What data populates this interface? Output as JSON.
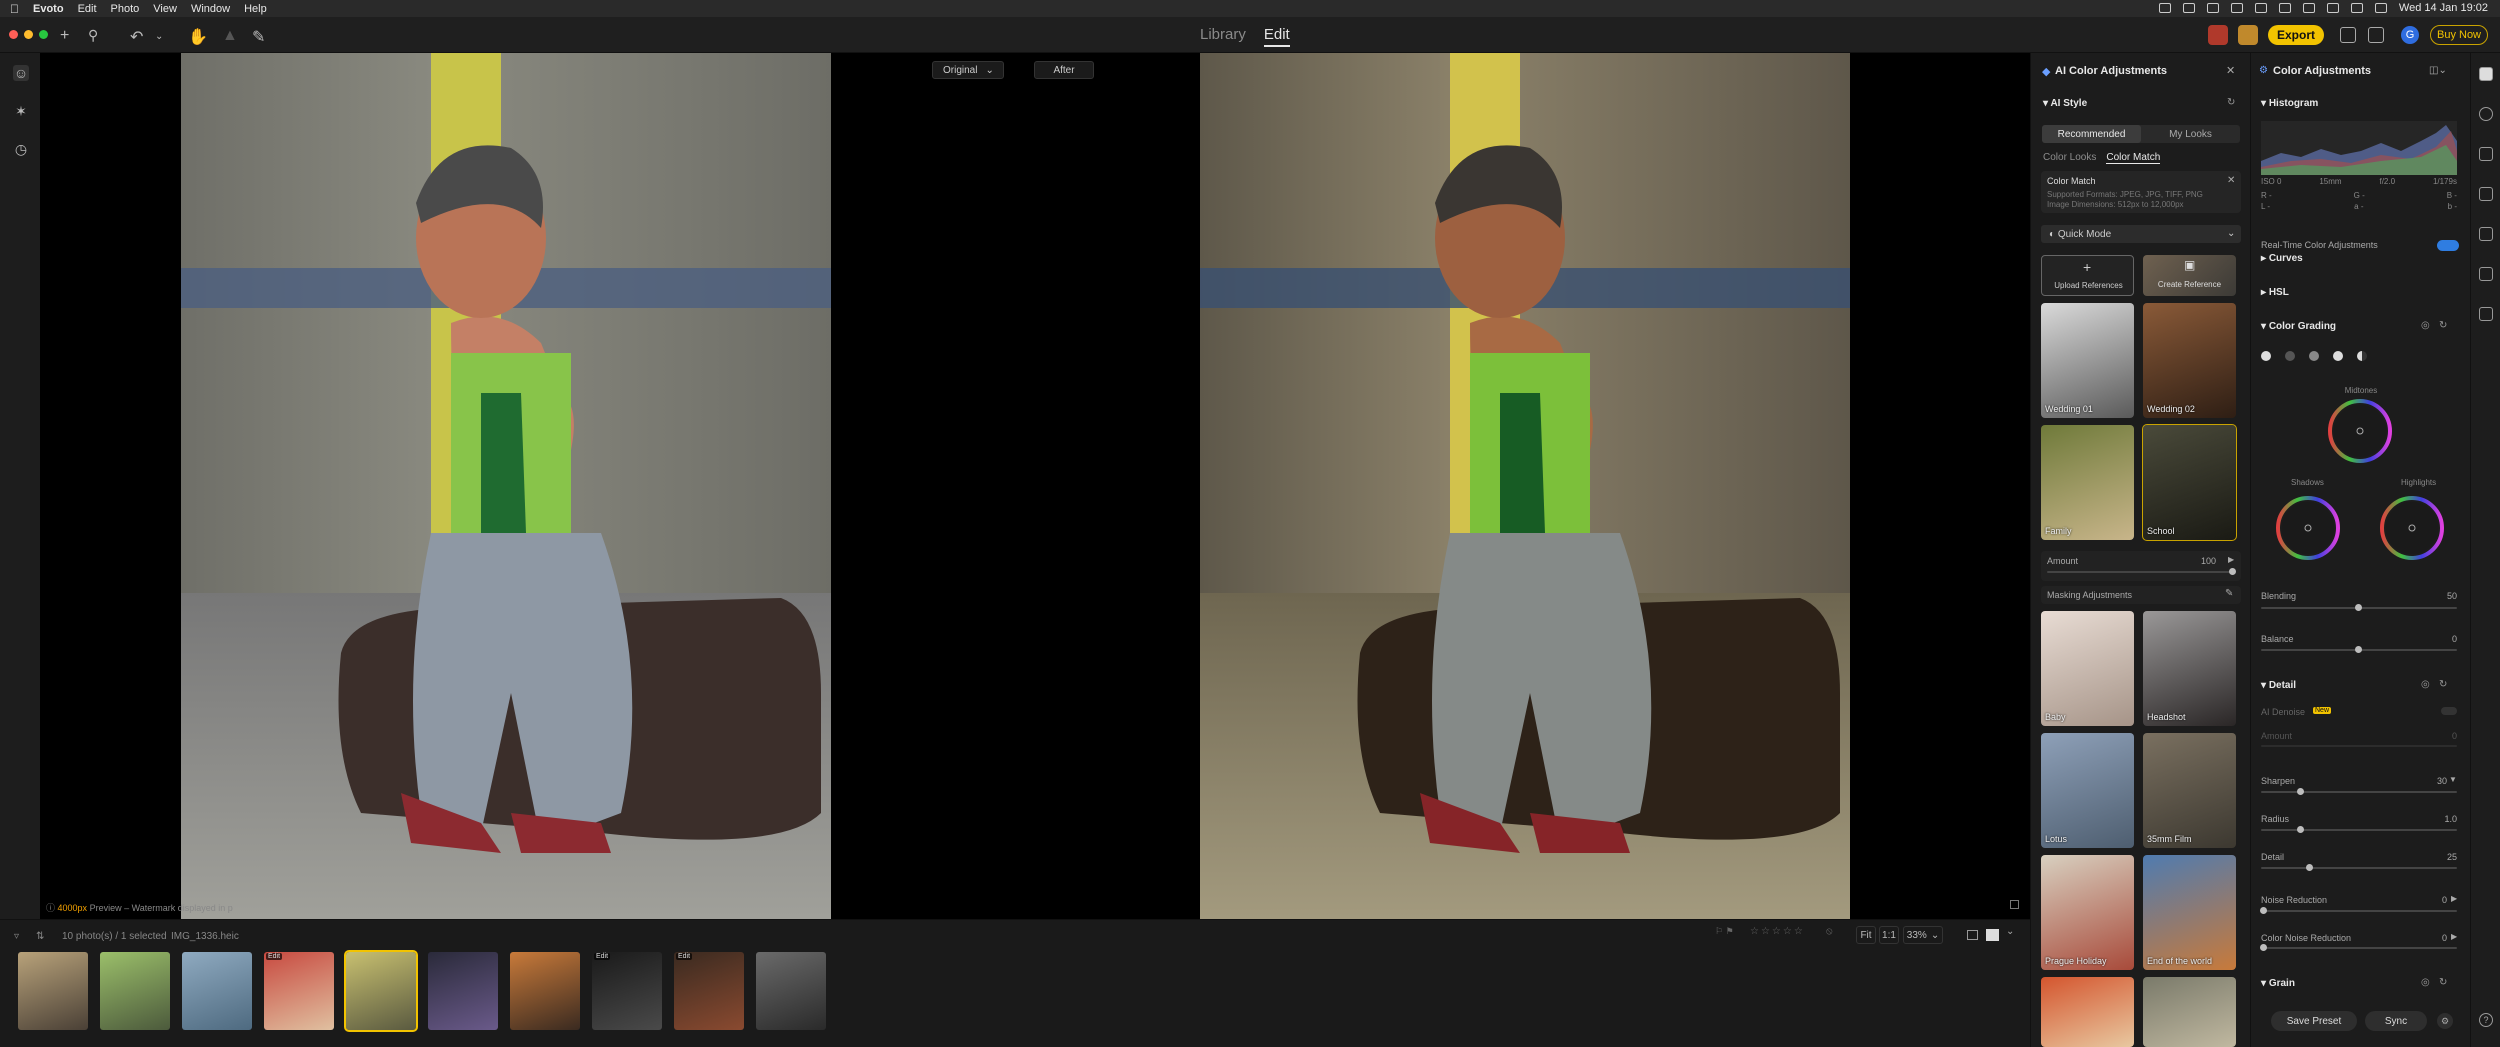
{
  "menubar": {
    "app": "Evoto",
    "items": [
      "Edit",
      "Photo",
      "View",
      "Window",
      "Help"
    ],
    "datetime": "Wed 14 Jan  19:02"
  },
  "toolbar": {
    "tabs": [
      {
        "label": "Library"
      },
      {
        "label": "Edit"
      }
    ],
    "export_label": "Export",
    "buy_label": "Buy Now",
    "avatar_letter": "G"
  },
  "compare": {
    "original_label": "Original",
    "after_label": "After"
  },
  "canvas": {
    "preview_highlight": "4000px",
    "preview_text": " Preview – Watermark displayed in p"
  },
  "filmstrip": {
    "count_text": "10 photo(s) / 1 selected",
    "filename": "IMG_1336.heic",
    "fit_label": "Fit",
    "one_to_one": "1:1",
    "zoom": "33%",
    "thumb_badge": "Edit",
    "selected_index": 4
  },
  "ai_panel": {
    "title": "AI Color Adjustments",
    "section": "AI Style",
    "seg_tabs": [
      "Recommended",
      "My Looks"
    ],
    "sub_tabs": [
      "Color Looks",
      "Color Match"
    ],
    "card_title": "Color Match",
    "card_formats": "Supported Formats: JPEG, JPG, TIFF, PNG",
    "card_dims": "Image Dimensions: 512px to 12,000px",
    "quick_mode": "Quick Mode",
    "upload_label": "Upload References",
    "create_label": "Create Reference",
    "looks_top": [
      "Wedding 01",
      "Wedding 02",
      "Family",
      "School"
    ],
    "amount_label": "Amount",
    "amount_value": "100",
    "masking_label": "Masking Adjustments",
    "looks_bottom": [
      "Baby",
      "Headshot",
      "Lotus",
      "35mm Film",
      "Prague Holiday",
      "End of the world"
    ]
  },
  "adj_panel": {
    "title": "Color Adjustments",
    "histogram_label": "Histogram",
    "exif": [
      "ISO 0",
      "15mm",
      "f/2.0",
      "1/179s"
    ],
    "rgb_labels": [
      "R -",
      "G -",
      "B -",
      "L -",
      "a -",
      "b -"
    ],
    "realtime_label": "Real-Time Color Adjustments",
    "curves_label": "Curves",
    "hsl_label": "HSL",
    "color_grading_label": "Color Grading",
    "midtones_label": "Midtones",
    "shadows_label": "Shadows",
    "highlights_label": "Highlights",
    "blending_label": "Blending",
    "blending_value": "50",
    "balance_label": "Balance",
    "balance_value": "0",
    "detail_label": "Detail",
    "ai_denoise_label": "AI Denoise",
    "new_badge": "New",
    "amount_label": "Amount",
    "amount_value": "0",
    "sharpen_label": "Sharpen",
    "sharpen_value": "30",
    "radius_label": "Radius",
    "radius_value": "1.0",
    "detail_sub_label": "Detail",
    "detail_value": "25",
    "noise_label": "Noise Reduction",
    "noise_value": "0",
    "color_noise_label": "Color Noise Reduction",
    "color_noise_value": "0",
    "grain_label": "Grain",
    "save_preset": "Save Preset",
    "sync": "Sync"
  },
  "colors": {
    "accent": "#f2c300",
    "panel": "#1c1c1c",
    "canvas": "#000000",
    "toggle": "#2f7de1"
  }
}
